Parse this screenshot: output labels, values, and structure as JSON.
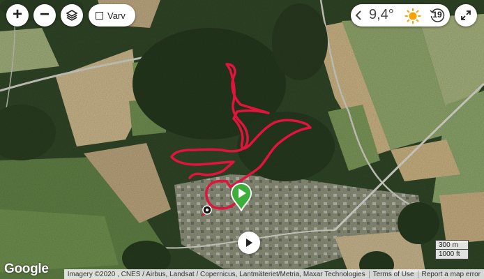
{
  "map": {
    "zoom_in_label": "+",
    "zoom_out_label": "−",
    "layers_icon": "layers-icon",
    "layer_toggle": {
      "label": "Varv",
      "checked": false
    },
    "fullscreen_icon": "expand-icon"
  },
  "weather": {
    "temperature": "9,4°",
    "condition_icon": "sun-icon",
    "forecast_count": "19",
    "prev_icon": "chevron-left-icon"
  },
  "scale": {
    "metric": "300 m",
    "imperial": "1000 ft"
  },
  "branding": {
    "logo": "Google"
  },
  "attribution": {
    "imagery": "Imagery ©2020 , CNES / Airbus, Landsat / Copernicus, Lantmäteriet/Metria, Maxar Technologies",
    "terms": "Terms of Use",
    "report": "Report a map error"
  },
  "route": {
    "color": "#e0143c",
    "start_marker": "play-flag-icon",
    "end_marker": "finish-dot-icon"
  },
  "playback": {
    "button_icon": "play-icon"
  },
  "colors": {
    "forest": "#2b3f22",
    "field_light": "#cdb98c",
    "field_green": "#6f8f4f",
    "marker_green": "#3cae3c"
  }
}
